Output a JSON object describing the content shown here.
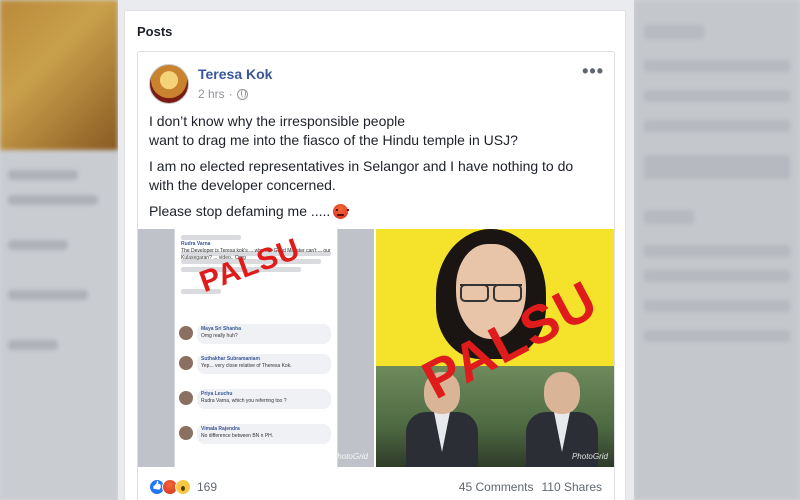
{
  "section_heading": "Posts",
  "post": {
    "author": "Teresa Kok",
    "timestamp": "2 hrs",
    "separator": "·",
    "privacy_icon": "globe-icon",
    "more_icon": "more-options-icon",
    "paragraphs": [
      "I don’t know why the irresponsible people",
      "want to drag me into the fiasco of the Hindu temple in USJ?",
      "I am no elected representatives in Selangor and I have nothing to do",
      "with the developer concerned.",
      "Please stop defaming me ....."
    ],
    "images": {
      "left_stamp": "PALSU",
      "right_stamp": "PALSU",
      "watermark": "PhotoGrid",
      "comments": [
        {
          "name": "Rudra Varna",
          "text": "The Developer is Teresa kok's ... why our Good Minister can't ... our Kulasegaran? ... video.. Omg"
        },
        {
          "name": "Maya Sri Shanha",
          "text": "Omg really huh?"
        },
        {
          "name": "Suthakhar Subramaniam",
          "text": "Yep... very close relative of Theresa Kok."
        },
        {
          "name": "Priya Leuchu",
          "text": "Rudra Varna, which you referring too ?"
        },
        {
          "name": "Vimala Rajendra",
          "text": "No difference between BN n PH."
        }
      ]
    },
    "reactions": {
      "icons": [
        "like-icon",
        "angry-icon",
        "wow-icon"
      ],
      "count": "169"
    },
    "comments_count": "45 Comments",
    "shares_count": "110 Shares"
  },
  "colors": {
    "link_blue": "#385898",
    "stamp_red": "#e01b1b",
    "background": "#e9ebee"
  }
}
